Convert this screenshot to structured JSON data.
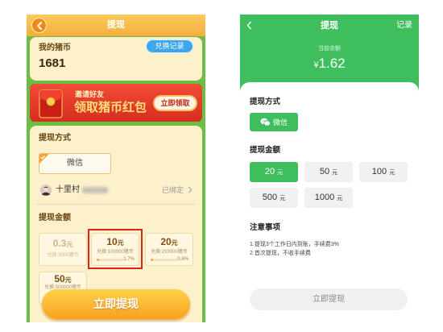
{
  "left": {
    "header": {
      "title": "提现"
    },
    "coins": {
      "label": "我的猪币",
      "value": "1681",
      "records_button": "兑换记录"
    },
    "banner": {
      "line1": "邀请好友",
      "line2": "领取猪币红包",
      "button": "立即领取"
    },
    "method": {
      "label": "提现方式",
      "option": "微信",
      "account_name": "十里村",
      "bound_status": "已绑定"
    },
    "amount": {
      "label": "提现金额",
      "options": [
        {
          "amount": "0.3",
          "unit": "元",
          "cost": "兑换:3000猪币",
          "disabled": true
        },
        {
          "amount": "10",
          "unit": "元",
          "cost": "兑换:100000猪币",
          "progress": "1.7%",
          "highlighted": true
        },
        {
          "amount": "20",
          "unit": "元",
          "cost": "兑换:200000猪币",
          "progress": "0.8%"
        },
        {
          "amount": "50",
          "unit": "元",
          "cost": "兑换:500000猪币"
        }
      ]
    },
    "submit_button": "立即提现"
  },
  "right": {
    "header": {
      "title": "提现",
      "records_link": "记录"
    },
    "balance": {
      "label": "当前余额",
      "currency": "¥",
      "value": "1.62"
    },
    "method": {
      "label": "提现方式",
      "option": "微信"
    },
    "amount": {
      "label": "提现金额",
      "options": [
        {
          "amount": "20",
          "unit": "元",
          "selected": true
        },
        {
          "amount": "50",
          "unit": "元",
          "selected": false
        },
        {
          "amount": "100",
          "unit": "元",
          "selected": false
        },
        {
          "amount": "500",
          "unit": "元",
          "selected": false
        },
        {
          "amount": "1000",
          "unit": "元",
          "selected": false
        }
      ]
    },
    "notes": {
      "label": "注意事项",
      "items": [
        "1.提现3个工作日内到账，手续费3%",
        "2.首次提现，不收手续费"
      ]
    },
    "submit_button": "立即提现"
  },
  "icons": {
    "left_back": "chevron-left-icon",
    "banner": "red-envelope-icon",
    "method_check": "check-corner-icon",
    "account": "avatar",
    "bound": "chevron-right-icon",
    "right_back": "chevron-left-icon",
    "wechat": "wechat-icon"
  },
  "colors": {
    "left_header_top": "#fcca5c",
    "left_header": "#f4ae3c",
    "left_frame": "#6cbf45",
    "left_card": "#fdf1cc",
    "records_blue": "#3ea6ee",
    "banner_red": "#d82d1f",
    "highlight_red": "#d8261b",
    "right_green": "#3fbe5d"
  }
}
